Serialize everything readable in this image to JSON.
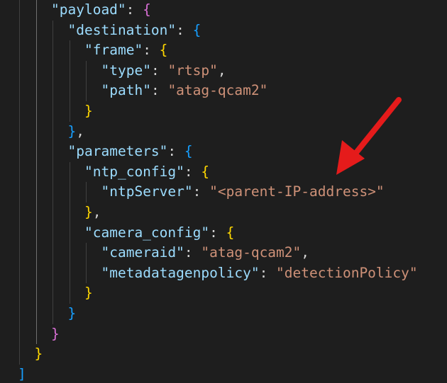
{
  "lines": [
    {
      "indent": 2,
      "tokens": [
        {
          "t": "\"payload\"",
          "c": "k"
        },
        {
          "t": ": ",
          "c": "p"
        },
        {
          "t": "{",
          "c": "b2"
        }
      ]
    },
    {
      "indent": 3,
      "tokens": [
        {
          "t": "\"destination\"",
          "c": "k"
        },
        {
          "t": ": ",
          "c": "p"
        },
        {
          "t": "{",
          "c": "b3"
        }
      ]
    },
    {
      "indent": 4,
      "tokens": [
        {
          "t": "\"frame\"",
          "c": "k"
        },
        {
          "t": ": ",
          "c": "p"
        },
        {
          "t": "{",
          "c": "b1"
        }
      ]
    },
    {
      "indent": 5,
      "tokens": [
        {
          "t": "\"type\"",
          "c": "k"
        },
        {
          "t": ": ",
          "c": "p"
        },
        {
          "t": "\"rtsp\"",
          "c": "s"
        },
        {
          "t": ",",
          "c": "p"
        }
      ]
    },
    {
      "indent": 5,
      "tokens": [
        {
          "t": "\"path\"",
          "c": "k"
        },
        {
          "t": ": ",
          "c": "p"
        },
        {
          "t": "\"atag-qcam2\"",
          "c": "s"
        }
      ]
    },
    {
      "indent": 4,
      "tokens": [
        {
          "t": "}",
          "c": "b1"
        }
      ]
    },
    {
      "indent": 3,
      "tokens": [
        {
          "t": "}",
          "c": "b3"
        },
        {
          "t": ",",
          "c": "p"
        }
      ]
    },
    {
      "indent": 3,
      "tokens": [
        {
          "t": "\"parameters\"",
          "c": "k"
        },
        {
          "t": ": ",
          "c": "p"
        },
        {
          "t": "{",
          "c": "b3"
        }
      ]
    },
    {
      "indent": 4,
      "tokens": [
        {
          "t": "\"ntp_config\"",
          "c": "k"
        },
        {
          "t": ": ",
          "c": "p"
        },
        {
          "t": "{",
          "c": "b1"
        }
      ]
    },
    {
      "indent": 5,
      "tokens": [
        {
          "t": "\"ntpServer\"",
          "c": "k"
        },
        {
          "t": ": ",
          "c": "p"
        },
        {
          "t": "\"<parent-IP-address>\"",
          "c": "s"
        }
      ]
    },
    {
      "indent": 4,
      "tokens": [
        {
          "t": "}",
          "c": "b1"
        },
        {
          "t": ",",
          "c": "p"
        }
      ]
    },
    {
      "indent": 4,
      "tokens": [
        {
          "t": "\"camera_config\"",
          "c": "k"
        },
        {
          "t": ": ",
          "c": "p"
        },
        {
          "t": "{",
          "c": "b1"
        }
      ]
    },
    {
      "indent": 5,
      "tokens": [
        {
          "t": "\"cameraid\"",
          "c": "k"
        },
        {
          "t": ": ",
          "c": "p"
        },
        {
          "t": "\"atag-qcam2\"",
          "c": "s"
        },
        {
          "t": ",",
          "c": "p"
        }
      ]
    },
    {
      "indent": 5,
      "tokens": [
        {
          "t": "\"metadatagenpolicy\"",
          "c": "k"
        },
        {
          "t": ": ",
          "c": "p"
        },
        {
          "t": "\"detectionPolicy\"",
          "c": "s"
        }
      ]
    },
    {
      "indent": 4,
      "tokens": [
        {
          "t": "}",
          "c": "b1"
        }
      ]
    },
    {
      "indent": 3,
      "tokens": [
        {
          "t": "}",
          "c": "b3"
        }
      ]
    },
    {
      "indent": 2,
      "tokens": [
        {
          "t": "}",
          "c": "b2"
        }
      ]
    },
    {
      "indent": 1,
      "tokens": [
        {
          "t": "}",
          "c": "b1"
        }
      ]
    },
    {
      "indent": 0,
      "tokens": [
        {
          "t": "]",
          "c": "b3"
        }
      ]
    }
  ],
  "theme": {
    "background": "#1e1e1e",
    "key": "#9cdcfe",
    "string": "#ce9178",
    "punctuation": "#d4d4d4",
    "bracket_gold": "#ffd700",
    "bracket_orchid": "#da70d6",
    "bracket_blue": "#179fff",
    "arrow": "#e51b1b"
  },
  "annotation": {
    "icon": "red-arrow-icon",
    "points_to": "ntpServer value"
  }
}
